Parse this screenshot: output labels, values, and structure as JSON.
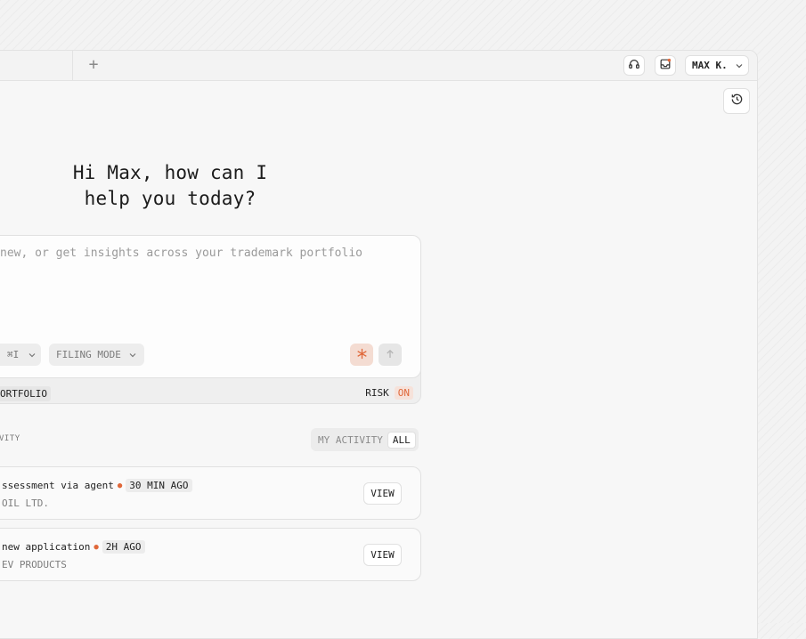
{
  "topbar": {
    "add_tab_label": "+",
    "user_name": "MAX K."
  },
  "main": {
    "greeting_line1": "Hi Max, how can I",
    "greeting_line2": "help you today?"
  },
  "composer": {
    "placeholder": "new, or get insights across your trademark portfolio",
    "shortcut": "⌘I",
    "mode_label": "FILING MODE",
    "footer_left": "ORTFOLIO",
    "risk_label": "RISK",
    "risk_value": "ON"
  },
  "activity": {
    "section_label": "VITY",
    "filter_mine": "MY ACTIVITY",
    "filter_all": "ALL",
    "items": [
      {
        "title": "ssessment via agent",
        "time": "30 MIN AGO",
        "subtitle": "OIL LTD.",
        "action": "VIEW"
      },
      {
        "title": "new application",
        "time": "2H AGO",
        "subtitle": "EV PRODUCTS",
        "action": "VIEW"
      }
    ]
  },
  "colors": {
    "accent": "#e0683a",
    "accent_soft": "#f4dcd2",
    "surface": "#f7f7f7"
  },
  "icons": [
    "plus-icon",
    "headset-icon",
    "inbox-icon",
    "chevron-down-icon",
    "history-icon",
    "asterisk-icon",
    "arrow-up-icon"
  ]
}
